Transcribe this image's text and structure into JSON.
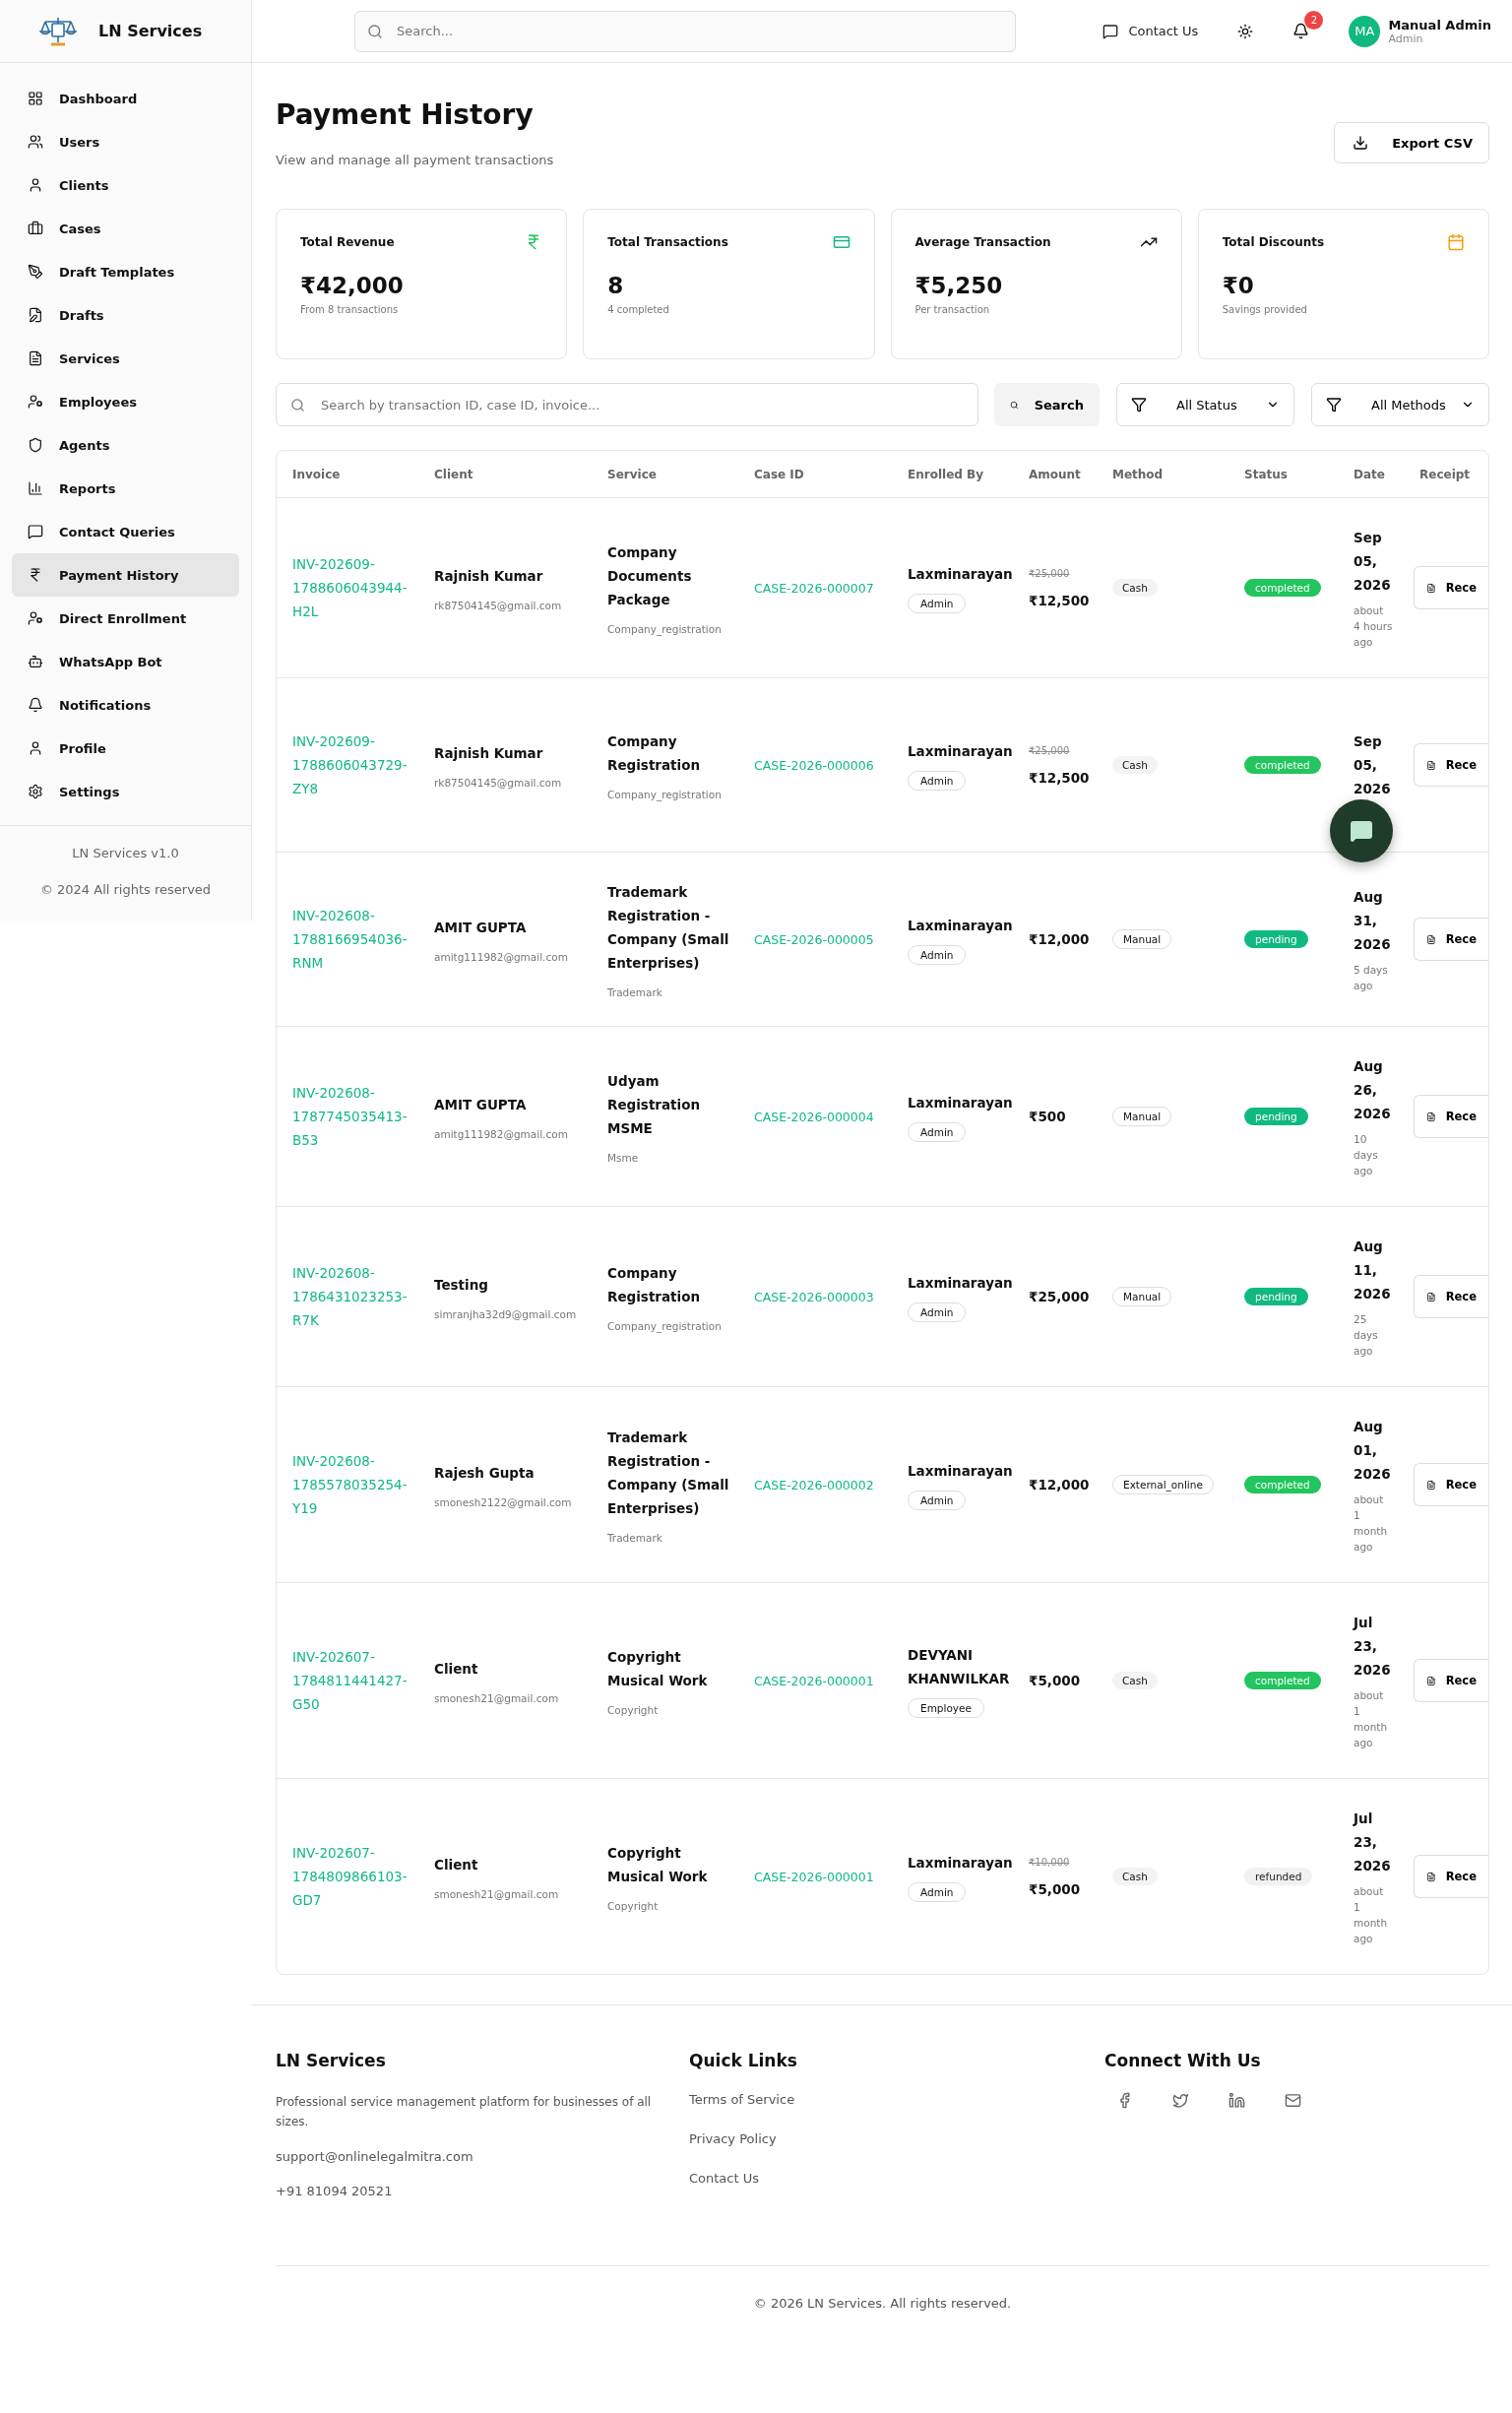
{
  "brand": {
    "name": "LN Services"
  },
  "sidebar": {
    "items": [
      {
        "label": "Dashboard",
        "selected": false
      },
      {
        "label": "Users",
        "selected": false
      },
      {
        "label": "Clients",
        "selected": false
      },
      {
        "label": "Cases",
        "selected": false
      },
      {
        "label": "Draft Templates",
        "selected": false
      },
      {
        "label": "Drafts",
        "selected": false
      },
      {
        "label": "Services",
        "selected": false
      },
      {
        "label": "Employees",
        "selected": false
      },
      {
        "label": "Agents",
        "selected": false
      },
      {
        "label": "Reports",
        "selected": false
      },
      {
        "label": "Contact Queries",
        "selected": false
      },
      {
        "label": "Payment History",
        "selected": true
      },
      {
        "label": "Direct Enrollment",
        "selected": false
      },
      {
        "label": "WhatsApp Bot",
        "selected": false
      },
      {
        "label": "Notifications",
        "selected": false
      },
      {
        "label": "Profile",
        "selected": false
      },
      {
        "label": "Settings",
        "selected": false
      }
    ],
    "version": "LN Services v1.0",
    "copyright": "© 2024 All rights reserved"
  },
  "header": {
    "search_placeholder": "Search...",
    "contact": "Contact Us",
    "notification_count": "2",
    "user": {
      "initials": "MA",
      "name": "Manual Admin",
      "role": "Admin"
    }
  },
  "page": {
    "title": "Payment History",
    "subtitle": "View and manage all payment transactions",
    "export_button": "Export CSV"
  },
  "stats": [
    {
      "title": "Total Revenue",
      "value": "₹42,000",
      "note": "From 8 transactions"
    },
    {
      "title": "Total Transactions",
      "value": "8",
      "note": "4 completed"
    },
    {
      "title": "Average Transaction",
      "value": "₹5,250",
      "note": "Per transaction"
    },
    {
      "title": "Total Discounts",
      "value": "₹0",
      "note": "Savings provided"
    }
  ],
  "filters": {
    "search_placeholder": "Search by transaction ID, case ID, invoice...",
    "search_button": "Search",
    "status": "All Status",
    "method": "All Methods"
  },
  "table": {
    "columns": [
      "Invoice",
      "Client",
      "Service",
      "Case ID",
      "Enrolled By",
      "Amount",
      "Method",
      "Status",
      "Date",
      "Receipt"
    ],
    "rows": [
      {
        "invoice": "INV-202609-1788606043944-H2L",
        "client": "Rajnish Kumar",
        "email": "rk87504145@gmail.com",
        "service": "Company Documents Package",
        "category": "Company_registration",
        "case_id": "CASE-2026-000007",
        "enrolled_by": "Laxminarayan",
        "role": "Admin",
        "original_amount": "₹25,000",
        "amount": "₹12,500",
        "method": "Cash",
        "status": {
          "label": "completed",
          "kind": "success"
        },
        "date": "Sep 05, 2026",
        "ago": "about 4 hours ago",
        "receipt": "Rece"
      },
      {
        "invoice": "INV-202609-1788606043729-ZY8",
        "client": "Rajnish Kumar",
        "email": "rk87504145@gmail.com",
        "service": "Company Registration",
        "category": "Company_registration",
        "case_id": "CASE-2026-000006",
        "enrolled_by": "Laxminarayan",
        "role": "Admin",
        "original_amount": "₹25,000",
        "amount": "₹12,500",
        "method": "Cash",
        "status": {
          "label": "completed",
          "kind": "success"
        },
        "date": "Sep 05, 2026",
        "receipt": "Rece"
      },
      {
        "invoice": "INV-202608-1788166954036-RNM",
        "client": "AMIT GUPTA",
        "email": "amitg111982@gmail.com",
        "service": "Trademark Registration - Company (Small Enterprises)",
        "category": "Trademark",
        "case_id": "CASE-2026-000005",
        "enrolled_by": "Laxminarayan",
        "role": "Admin",
        "amount": "₹12,000",
        "method": "Manual",
        "status": {
          "label": "pending",
          "kind": "pending"
        },
        "date": "Aug 31, 2026",
        "ago": "5 days ago",
        "receipt": "Rece"
      },
      {
        "invoice": "INV-202608-1787745035413-B53",
        "client": "AMIT GUPTA",
        "email": "amitg111982@gmail.com",
        "service": "Udyam Registration MSME",
        "category": "Msme",
        "case_id": "CASE-2026-000004",
        "enrolled_by": "Laxminarayan",
        "role": "Admin",
        "amount": "₹500",
        "method": "Manual",
        "status": {
          "label": "pending",
          "kind": "pending"
        },
        "date": "Aug 26, 2026",
        "ago": "10 days ago",
        "receipt": "Rece"
      },
      {
        "invoice": "INV-202608-1786431023253-R7K",
        "client": "Testing",
        "email": "simranjha32d9@gmail.com",
        "service": "Company Registration",
        "category": "Company_registration",
        "case_id": "CASE-2026-000003",
        "enrolled_by": "Laxminarayan",
        "role": "Admin",
        "amount": "₹25,000",
        "method": "Manual",
        "status": {
          "label": "pending",
          "kind": "pending"
        },
        "date": "Aug 11, 2026",
        "ago": "25 days ago",
        "receipt": "Rece"
      },
      {
        "invoice": "INV-202608-1785578035254-Y19",
        "client": "Rajesh Gupta",
        "email": "smonesh2122@gmail.com",
        "service": "Trademark Registration - Company (Small Enterprises)",
        "category": "Trademark",
        "case_id": "CASE-2026-000002",
        "enrolled_by": "Laxminarayan",
        "role": "Admin",
        "amount": "₹12,000",
        "method": "External_online",
        "status": {
          "label": "completed",
          "kind": "success"
        },
        "date": "Aug 01, 2026",
        "ago": "about 1 month ago",
        "receipt": "Rece"
      },
      {
        "invoice": "INV-202607-1784811441427-G50",
        "client": "Client",
        "email": "smonesh21@gmail.com",
        "service": "Copyright Musical Work",
        "category": "Copyright",
        "case_id": "CASE-2026-000001",
        "enrolled_by": "DEVYANI KHANWILKAR",
        "role": "Employee",
        "amount": "₹5,000",
        "method": "Cash",
        "status": {
          "label": "completed",
          "kind": "success"
        },
        "date": "Jul 23, 2026",
        "ago": "about 1 month ago",
        "receipt": "Rece"
      },
      {
        "invoice": "INV-202607-1784809866103-GD7",
        "client": "Client",
        "email": "smonesh21@gmail.com",
        "service": "Copyright Musical Work",
        "category": "Copyright",
        "case_id": "CASE-2026-000001",
        "enrolled_by": "Laxminarayan",
        "role": "Admin",
        "original_amount": "₹10,000",
        "amount": "₹5,000",
        "method": "Cash",
        "status": {
          "label": "refunded",
          "kind": "neutral"
        },
        "date": "Jul 23, 2026",
        "ago": "about 1 month ago",
        "receipt": "Rece"
      }
    ]
  },
  "footer": {
    "brand": "LN Services",
    "description": "Professional service management platform for businesses of all sizes.",
    "email": "support@onlinelegalmitra.com",
    "phone": "+91 81094 20521",
    "links_title": "Quick Links",
    "links": [
      "Terms of Service",
      "Privacy Policy",
      "Contact Us"
    ],
    "social_title": "Connect With Us",
    "copyright": "© 2026 LN Services. All rights reserved."
  }
}
